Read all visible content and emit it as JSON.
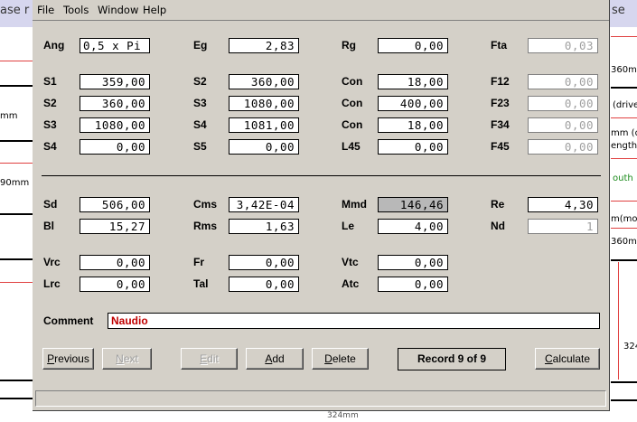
{
  "background": {
    "top_left_text": "ase r",
    "top_right_text": "se",
    "left_labels": [
      "mm",
      "90mm"
    ],
    "right_labels": [
      "360mm",
      "(drive",
      "mm (dri",
      "ength)",
      "outh",
      "m(mou",
      "360mm",
      "324"
    ],
    "bottom_text": "324mm"
  },
  "menu": [
    "File",
    "Tools",
    "Window",
    "Help"
  ],
  "top_section": [
    [
      {
        "label": "Ang",
        "value": "0,5 x Pi",
        "align": "left"
      },
      {
        "label": "Eg",
        "value": "2,83"
      },
      {
        "label": "Rg",
        "value": "0,00"
      },
      {
        "label": "Fta",
        "value": "0,03",
        "readonly": true
      }
    ],
    [
      {
        "label": "S1",
        "value": "359,00"
      },
      {
        "label": "S2",
        "value": "360,00"
      },
      {
        "label": "Con",
        "value": "18,00"
      },
      {
        "label": "F12",
        "value": "0,00",
        "readonly": true
      }
    ],
    [
      {
        "label": "S2",
        "value": "360,00"
      },
      {
        "label": "S3",
        "value": "1080,00"
      },
      {
        "label": "Con",
        "value": "400,00"
      },
      {
        "label": "F23",
        "value": "0,00",
        "readonly": true
      }
    ],
    [
      {
        "label": "S3",
        "value": "1080,00"
      },
      {
        "label": "S4",
        "value": "1081,00"
      },
      {
        "label": "Con",
        "value": "18,00"
      },
      {
        "label": "F34",
        "value": "0,00",
        "readonly": true
      }
    ],
    [
      {
        "label": "S4",
        "value": "0,00"
      },
      {
        "label": "S5",
        "value": "0,00"
      },
      {
        "label": "L45",
        "value": "0,00"
      },
      {
        "label": "F45",
        "value": "0,00",
        "readonly": true
      }
    ]
  ],
  "bottom_section": [
    [
      {
        "label": "Sd",
        "value": "506,00"
      },
      {
        "label": "Cms",
        "value": "3,42E-04"
      },
      {
        "label": "Mmd",
        "value": "146,46",
        "selected": true
      },
      {
        "label": "Re",
        "value": "4,30"
      }
    ],
    [
      {
        "label": "Bl",
        "value": "15,27"
      },
      {
        "label": "Rms",
        "value": "1,63"
      },
      {
        "label": "Le",
        "value": "4,00"
      },
      {
        "label": "Nd",
        "value": "1",
        "readonly": true
      }
    ],
    [
      {
        "label": "Vrc",
        "value": "0,00"
      },
      {
        "label": "Fr",
        "value": "0,00"
      },
      {
        "label": "Vtc",
        "value": "0,00"
      }
    ],
    [
      {
        "label": "Lrc",
        "value": "0,00"
      },
      {
        "label": "Tal",
        "value": "0,00"
      },
      {
        "label": "Atc",
        "value": "0,00"
      }
    ]
  ],
  "comment": {
    "label": "Comment",
    "value": "Naudio"
  },
  "buttons": {
    "previous": "Previous",
    "next": "Next",
    "edit": "Edit",
    "add": "Add",
    "delete": "Delete",
    "record": "Record 9 of 9",
    "calculate": "Calculate"
  }
}
